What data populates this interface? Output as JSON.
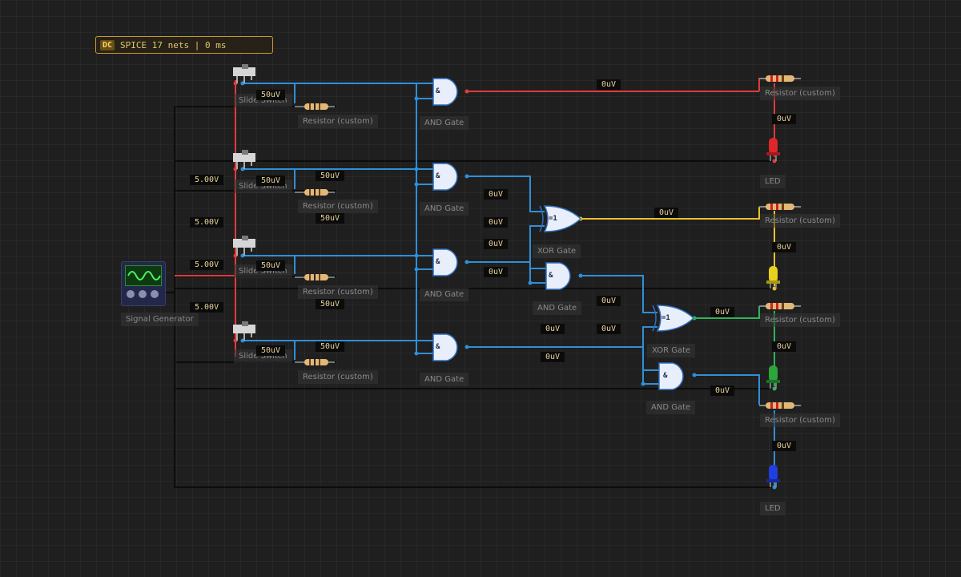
{
  "status": {
    "mode": "DC",
    "text": "SPICE 17 nets | 0 ms"
  },
  "components": {
    "slide_switch_1": "Slide Switch",
    "slide_switch_2": "Slide Switch",
    "slide_switch_3": "Slide Switch",
    "slide_switch_4": "Slide Switch",
    "resistor_1": "Resistor (custom)",
    "resistor_2": "Resistor (custom)",
    "resistor_3": "Resistor (custom)",
    "resistor_4": "Resistor (custom)",
    "resistor_out_1": "Resistor (custom)",
    "resistor_out_2": "Resistor (custom)",
    "resistor_out_3": "Resistor (custom)",
    "resistor_out_4": "Resistor (custom)",
    "and_gate_1": "AND Gate",
    "and_gate_2": "AND Gate",
    "and_gate_3": "AND Gate",
    "and_gate_4": "AND Gate",
    "and_gate_5": "AND Gate",
    "and_gate_6": "AND Gate",
    "xor_gate_1": "XOR Gate",
    "xor_gate_2": "XOR Gate",
    "led_1": "LED",
    "led_2": "LED",
    "signal_generator": "Signal Generator"
  },
  "gate_symbols": {
    "and": "&",
    "xor": "=1"
  },
  "probes": [
    "50uV",
    "50uV",
    "50uV",
    "50uV",
    "50uV",
    "50uV",
    "50uV",
    "50uV",
    "5.00V",
    "5.00V",
    "5.00V",
    "5.00V",
    "0uV",
    "0uV",
    "0uV",
    "0uV",
    "0uV",
    "0uV",
    "0uV",
    "0uV",
    "0uV",
    "0uV",
    "0uV",
    "0uV",
    "0uV",
    "0uV",
    "0uV",
    "0uV"
  ],
  "colors": {
    "wire_blue": "#2f8fd8",
    "wire_red": "#e03b3b",
    "wire_yellow": "#e8c22a",
    "wire_green": "#2fb35c",
    "wire_black": "#0c0c0c",
    "gate_fill": "#e8eefa",
    "led_red": "#e0262a",
    "led_yellow": "#e8d11e",
    "led_green": "#2ca63a",
    "led_blue": "#1f3fe0"
  },
  "icons": {
    "slide_switch": "slide-switch-icon",
    "resistor": "resistor-icon",
    "led": "led-icon",
    "sine_wave": "sine-wave-icon"
  }
}
